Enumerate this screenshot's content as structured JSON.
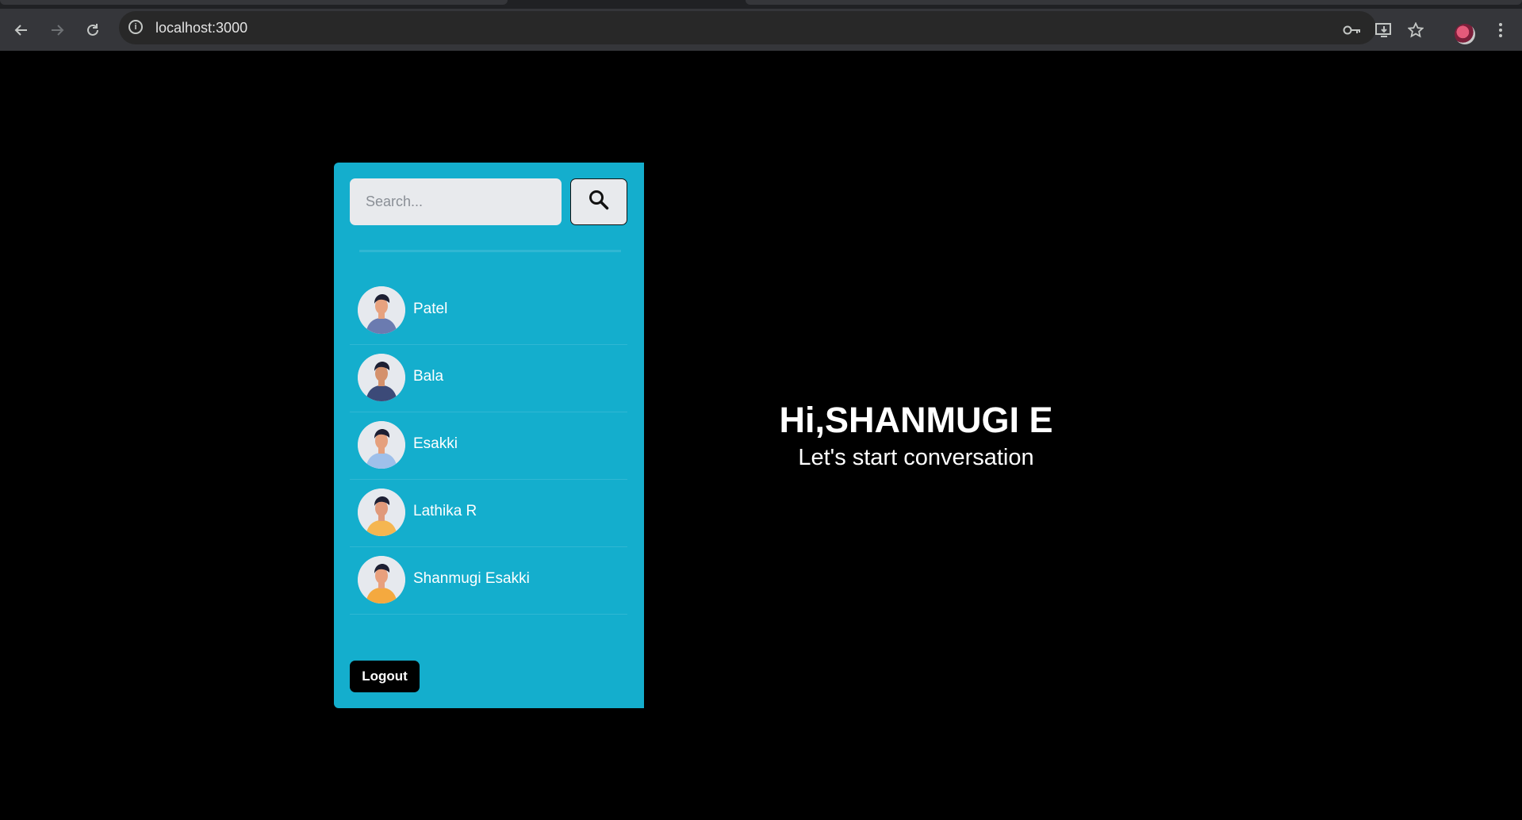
{
  "browser": {
    "url": "localhost:3000"
  },
  "sidebar": {
    "search": {
      "placeholder": "Search..."
    },
    "users": [
      {
        "name": "Patel",
        "avatar": "avatar-man-dark-hair",
        "shirt": "#6b7bb0",
        "skin": "#e7a27f"
      },
      {
        "name": "Bala",
        "avatar": "avatar-man-jacket",
        "shirt": "#3c4a78",
        "skin": "#d4916c"
      },
      {
        "name": "Esakki",
        "avatar": "avatar-man-light-shirt",
        "shirt": "#9fc0ea",
        "skin": "#e5a07d"
      },
      {
        "name": "Lathika R",
        "avatar": "avatar-woman-yellow",
        "shirt": "#f5b651",
        "skin": "#e0997a"
      },
      {
        "name": "Shanmugi Esakki",
        "avatar": "avatar-woman-bun",
        "shirt": "#f4a93f",
        "skin": "#e8a07d"
      }
    ],
    "logout_label": "Logout",
    "bg_color": "#14aecd"
  },
  "main": {
    "greeting": "Hi,SHANMUGI E",
    "subtitle": "Let's start conversation"
  }
}
